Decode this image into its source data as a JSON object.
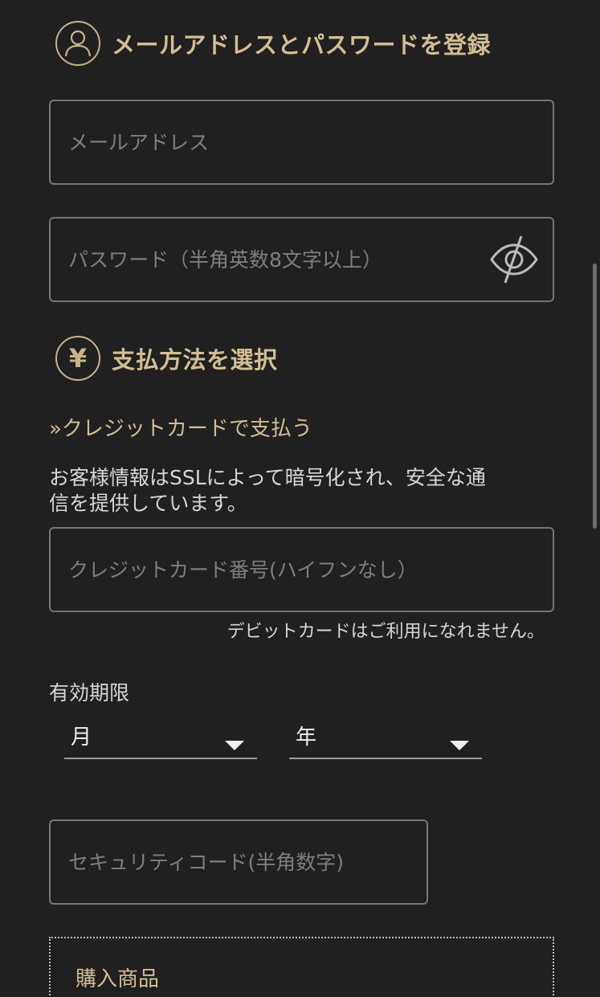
{
  "account_section": {
    "title": "メールアドレスとパスワードを登録",
    "icon": "user-icon"
  },
  "email_field": {
    "value": "",
    "placeholder": "メールアドレス"
  },
  "password_field": {
    "value": "",
    "placeholder": "パスワード（半角英数8文字以上）",
    "toggle_icon": "eye-slash-icon"
  },
  "payment_section": {
    "title": "支払方法を選択",
    "icon_glyph": "¥",
    "icon": "yen-icon"
  },
  "credit_card_link": "»クレジットカードで支払う",
  "ssl_notice": {
    "line1": "お客様情報はSSLによって暗号化され、安全な通",
    "line2": "信を提供しています。"
  },
  "card_number_field": {
    "value": "",
    "placeholder": "クレジットカード番号(ハイフンなし）"
  },
  "debit_notice": "デビットカードはご利用になれません。",
  "expiry": {
    "label": "有効期限",
    "month_label": "月",
    "year_label": "年"
  },
  "security_code_field": {
    "value": "",
    "placeholder": "セキュリティコード(半角数字)"
  },
  "product": {
    "label": "購入商品"
  },
  "colors": {
    "background": "#202020",
    "gold_accent": "#c8b48a",
    "field_border": "#6e7877",
    "text": "#e6e6e6",
    "placeholder": "#7b7f80"
  }
}
